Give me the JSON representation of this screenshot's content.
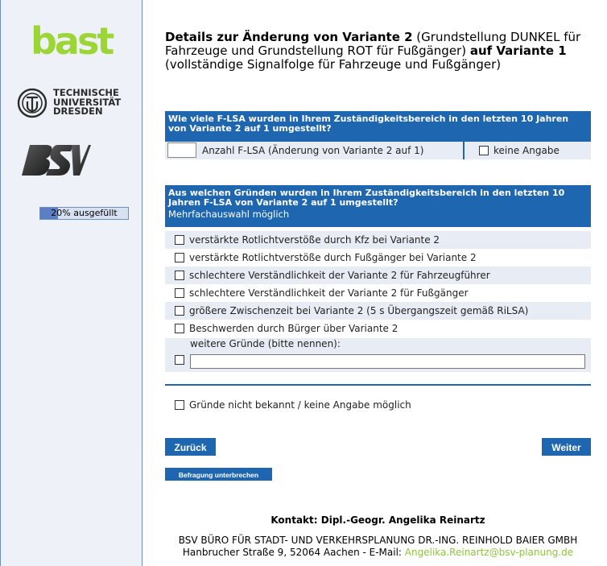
{
  "sidebar": {
    "logo_bast": "bast",
    "logo_tu": [
      "TECHNISCHE",
      "UNIVERSITÄT",
      "DRESDEN"
    ],
    "progress_label": "20% ausgefüllt",
    "progress_fraction": 0.2
  },
  "title": {
    "b1": "Details zur Änderung von Variante 2",
    "n1": " (Grundstellung DUNKEL für Fahrzeuge und Grundstellung ROT für Fußgänger) ",
    "b2": "auf Variante 1",
    "n2": " (vollständige Signalfolge für Fahrzeuge und Fußgänger)"
  },
  "q1": {
    "header": "Wie viele F-LSA wurden in Ihrem Zuständigkeitsbereich in den letzten 10 Jahren von Variante 2 auf 1 umgestellt?",
    "input_label": "Anzahl F-LSA (Änderung von Variante 2 auf 1)",
    "none_label": "keine Angabe"
  },
  "q2": {
    "header": "Aus welchen Gründen wurden in Ihrem Zuständigkeitsbereich in den letzten 10 Jahren F-LSA von Variante 2 auf 1 umgestellt?",
    "sub": "Mehrfachauswahl möglich",
    "options": [
      "verstärkte Rotlichtverstöße durch Kfz bei Variante 2",
      "verstärkte Rotlichtverstöße durch Fußgänger bei Variante 2",
      "schlechtere Verständlichkeit der Variante 2 für Fahrzeugführer",
      "schlechtere Verständlichkeit der Variante 2 für Fußgänger",
      "größere Zwischenzeit bei Variante 2 (5 s Übergangszeit gemäß RiLSA)",
      "Beschwerden durch Bürger über Variante 2"
    ],
    "other_label": "weitere Gründe (bitte nennen):",
    "unknown_label": "Gründe nicht bekannt / keine Angabe möglich"
  },
  "buttons": {
    "back": "Zurück",
    "next": "Weiter",
    "pause": "Befragung unterbrechen"
  },
  "footer": {
    "contact": "Kontakt: Dipl.-Geogr. Angelika Reinartz",
    "company": "BSV BÜRO FÜR STADT- UND VERKEHRSPLANUNG DR.-ING. REINHOLD BAIER GMBH",
    "address": "Hanbrucher Straße 9, 52064 Aachen - E-Mail: ",
    "email": "Angelika.Reinartz@bsv-planung.de"
  },
  "colors": {
    "accent": "#1e66b0",
    "bast_green": "#9bd636",
    "email_green": "#8dc63f"
  }
}
